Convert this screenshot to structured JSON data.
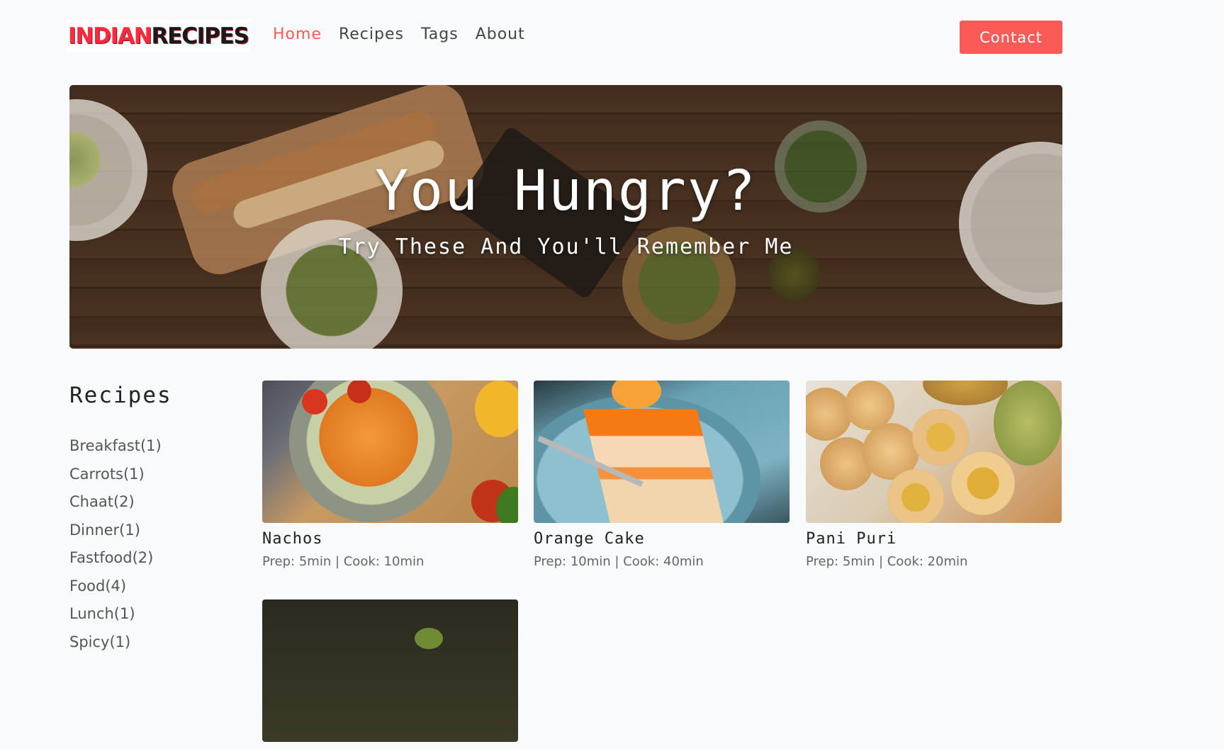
{
  "brand": {
    "logo_part1": "INDIAN",
    "logo_part2": "RECIPES"
  },
  "nav": {
    "items": [
      {
        "label": "Home",
        "active": true
      },
      {
        "label": "Recipes",
        "active": false
      },
      {
        "label": "Tags",
        "active": false
      },
      {
        "label": "About",
        "active": false
      }
    ],
    "contact_label": "Contact"
  },
  "hero": {
    "title": "You Hungry?",
    "subtitle": "Try These And You'll Remember Me"
  },
  "sidebar": {
    "title": "Recipes",
    "tags": [
      "Breakfast(1)",
      "Carrots(1)",
      "Chaat(2)",
      "Dinner(1)",
      "Fastfood(2)",
      "Food(4)",
      "Lunch(1)",
      "Spicy(1)"
    ]
  },
  "recipes": [
    {
      "title": "Nachos",
      "meta": "Prep: 5min | Cook: 10min"
    },
    {
      "title": "Orange Cake",
      "meta": "Prep: 10min | Cook: 40min"
    },
    {
      "title": "Pani Puri",
      "meta": "Prep: 5min | Cook: 20min"
    },
    {
      "title": "",
      "meta": ""
    }
  ],
  "colors": {
    "accent": "#fb5b56",
    "background": "#f9fafb",
    "logo_red": "#ff2a3d"
  }
}
